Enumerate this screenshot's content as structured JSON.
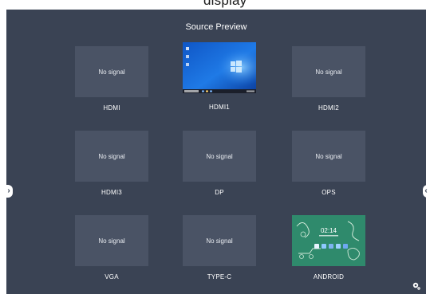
{
  "top_bar": {
    "text": "display"
  },
  "preview": {
    "title": "Source Preview",
    "no_signal_text": "No signal",
    "sources": [
      {
        "label": "HDMI",
        "status": "No signal"
      },
      {
        "label": "HDMI1",
        "status": "live",
        "preview": "windows-desktop"
      },
      {
        "label": "HDMI2",
        "status": "No signal"
      },
      {
        "label": "HDMI3",
        "status": "No signal"
      },
      {
        "label": "DP",
        "status": "No signal"
      },
      {
        "label": "OPS",
        "status": "No signal"
      },
      {
        "label": "VGA",
        "status": "No signal"
      },
      {
        "label": "TYPE-C",
        "status": "No signal"
      },
      {
        "label": "ANDROID",
        "status": "live",
        "preview": "android-home",
        "clock": "02:14"
      }
    ]
  },
  "icons": {
    "left_tab": "chevron-right-icon",
    "right_tab": "chevron-left-icon",
    "settings": "gear-icon"
  },
  "colors": {
    "background": "#3a4354",
    "tile": "#4a5365",
    "windows_blue": "#1f6fd8",
    "android_green": "#2f8a6c"
  }
}
